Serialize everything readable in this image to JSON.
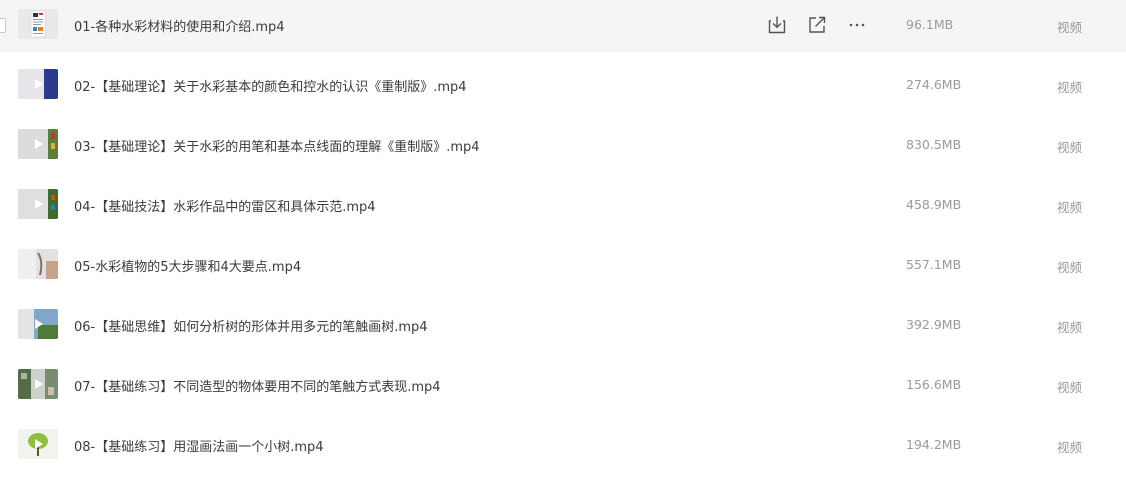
{
  "files": [
    {
      "name": "01-各种水彩材料的使用和介绍.mp4",
      "size": "96.1MB",
      "type": "视频",
      "thumb_icon": "document-thumbnail",
      "hovered": true,
      "actions": [
        {
          "icon": "download-icon"
        },
        {
          "icon": "share-icon"
        },
        {
          "icon": "more-icon"
        }
      ]
    },
    {
      "name": "02-【基础理论】关于水彩基本的颜色和控水的认识《重制版》.mp4",
      "size": "274.6MB",
      "type": "视频",
      "thumb_icon": "video-thumbnail"
    },
    {
      "name": "03-【基础理论】关于水彩的用笔和基本点线面的理解《重制版》.mp4",
      "size": "830.5MB",
      "type": "视频",
      "thumb_icon": "video-thumbnail"
    },
    {
      "name": "04-【基础技法】水彩作品中的雷区和具体示范.mp4",
      "size": "458.9MB",
      "type": "视频",
      "thumb_icon": "video-thumbnail"
    },
    {
      "name": "05-水彩植物的5大步骤和4大要点.mp4",
      "size": "557.1MB",
      "type": "视频",
      "thumb_icon": "video-thumbnail"
    },
    {
      "name": "06-【基础思维】如何分析树的形体并用多元的笔触画树.mp4",
      "size": "392.9MB",
      "type": "视频",
      "thumb_icon": "video-thumbnail"
    },
    {
      "name": "07-【基础练习】不同造型的物体要用不同的笔触方式表现.mp4",
      "size": "156.6MB",
      "type": "视频",
      "thumb_icon": "video-thumbnail"
    },
    {
      "name": "08-【基础练习】用湿画法画一个小树.mp4",
      "size": "194.2MB",
      "type": "视频",
      "thumb_icon": "video-thumbnail"
    }
  ],
  "colors": {
    "hover_row_bg": "#f5f5f6",
    "filename_text": "#3b3b3b",
    "meta_text": "#9a9a9a",
    "icon_stroke": "#555555"
  }
}
